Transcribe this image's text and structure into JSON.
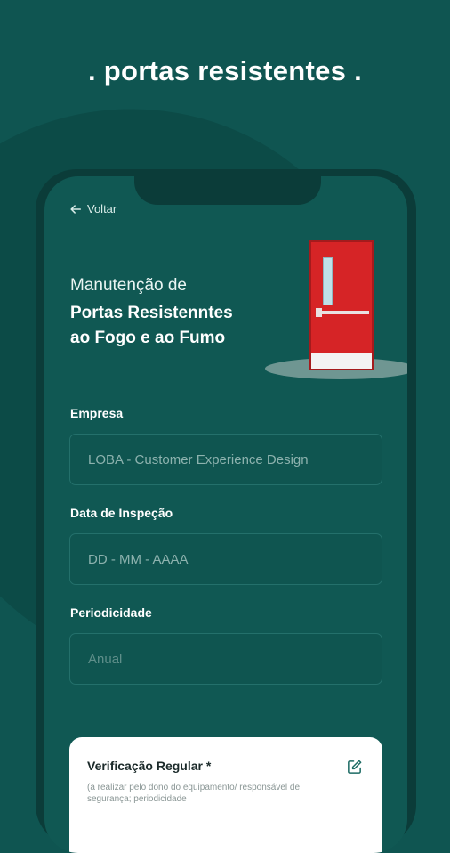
{
  "headline": ". portas resistentes .",
  "screen": {
    "back_label": "Voltar",
    "title_line1": "Manutenção de",
    "title_line2": "Portas Resistenntes",
    "title_line3": "ao Fogo e ao Fumo"
  },
  "form": {
    "empresa": {
      "label": "Empresa",
      "value": "LOBA - Customer Experience Design"
    },
    "data": {
      "label": "Data de Inspeção",
      "placeholder": "DD - MM - AAAA"
    },
    "periodicidade": {
      "label": "Periodicidade",
      "placeholder": "Anual"
    }
  },
  "card": {
    "title": "Verificação Regular *",
    "subtitle": "(a realizar pelo dono do equipamento/ responsável de segurança; periodicidade"
  },
  "colors": {
    "background": "#0f5551",
    "door": "#d62426",
    "card": "#ffffff"
  },
  "icons": {
    "back": "arrow-left-icon",
    "edit": "edit-icon",
    "door": "fire-door-illustration"
  }
}
